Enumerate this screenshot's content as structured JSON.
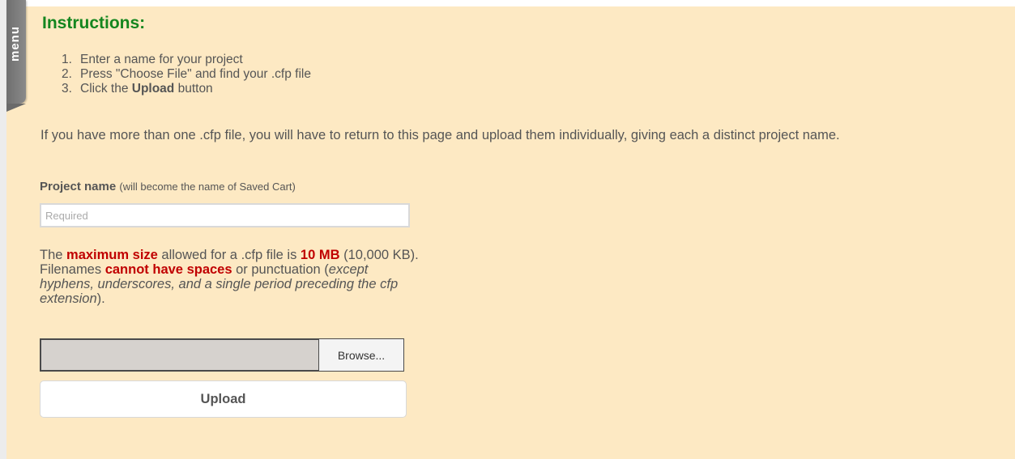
{
  "menu_tab": {
    "label": "menu"
  },
  "instructions": {
    "title": "Instructions:",
    "steps": [
      {
        "num": "1.",
        "text": "Enter a name for your project"
      },
      {
        "num": "2.",
        "text": "Press \"Choose File\" and find your .cfp file"
      },
      {
        "num": "3.",
        "pre": "Click the ",
        "bold": "Upload",
        "post": " button"
      }
    ],
    "multi_file_note": "If you have more than one .cfp file, you will have to return to this page and upload them individually, giving each a distinct project name."
  },
  "project_name": {
    "label": "Project name",
    "hint": "(will become the name of Saved Cart)",
    "placeholder": "Required",
    "value": ""
  },
  "size_note": {
    "t1": "The ",
    "r1": "maximum size",
    "t2": " allowed for a .cfp file is ",
    "r2": "10 MB",
    "t3": " (10,000 KB). Filenames ",
    "r3": "cannot have spaces",
    "t4": " or punctuation (",
    "i1": "except hyphens, underscores, and a single period preceding the cfp extension",
    "t5": ")."
  },
  "file_input": {
    "path": "",
    "browse_label": "Browse..."
  },
  "upload_button": {
    "label": "Upload"
  },
  "colors": {
    "background": "#fde9c3",
    "title_green": "#14861f",
    "highlight_red": "#c00000",
    "text_gray": "#555555"
  }
}
